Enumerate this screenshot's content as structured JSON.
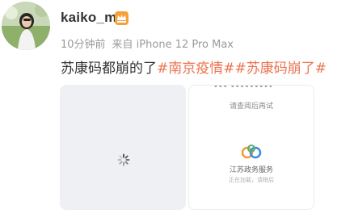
{
  "user": {
    "name": "kaiko_m"
  },
  "meta": {
    "time": "10分钟前",
    "source": "来自 iPhone 12 Pro Max"
  },
  "post": {
    "text": "苏康码都崩的了",
    "tags": [
      "#南京疫情#",
      "#苏康码崩了#"
    ]
  },
  "media": {
    "second": {
      "header": "•••   •••••••••",
      "subtitle": "请查阅后再试",
      "service_name": "江苏政务服务",
      "note": "正在加载，请稍后"
    }
  },
  "colors": {
    "tag": "#eb7350",
    "meta": "#9a9a9a",
    "badge": "#f7a13a"
  }
}
